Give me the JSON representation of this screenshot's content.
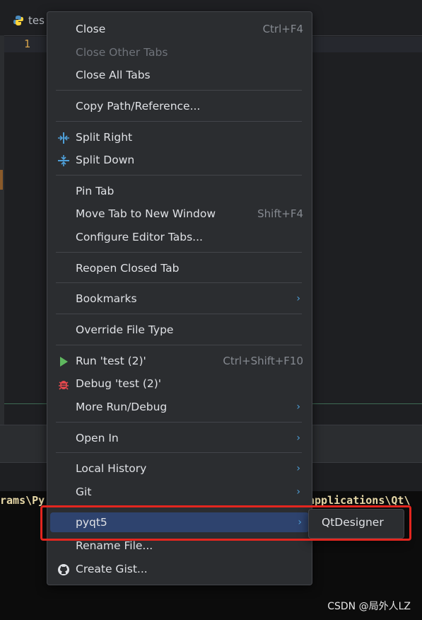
{
  "editor": {
    "tab_title": "tes",
    "line_number": "1",
    "terminal_left": "rams\\Py",
    "terminal_right": "applications\\Qt\\"
  },
  "menu": {
    "close": {
      "label": "Close",
      "shortcut": "Ctrl+F4"
    },
    "close_other": {
      "label": "Close Other Tabs"
    },
    "close_all": {
      "label": "Close All Tabs"
    },
    "copy_path": {
      "label": "Copy Path/Reference..."
    },
    "split_right": {
      "label": "Split Right",
      "icon": "split-right-icon"
    },
    "split_down": {
      "label": "Split Down",
      "icon": "split-down-icon"
    },
    "pin_tab": {
      "label": "Pin Tab"
    },
    "move_tab": {
      "label": "Move Tab to New Window",
      "shortcut": "Shift+F4"
    },
    "configure_tabs": {
      "label": "Configure Editor Tabs..."
    },
    "reopen_closed": {
      "label": "Reopen Closed Tab"
    },
    "bookmarks": {
      "label": "Bookmarks"
    },
    "override_type": {
      "label": "Override File Type"
    },
    "run": {
      "label": "Run 'test (2)'",
      "shortcut": "Ctrl+Shift+F10",
      "icon": "run-icon"
    },
    "debug": {
      "label": "Debug 'test (2)'",
      "icon": "debug-icon"
    },
    "more_run": {
      "label": "More Run/Debug"
    },
    "open_in": {
      "label": "Open In"
    },
    "local_history": {
      "label": "Local History"
    },
    "git": {
      "label": "Git"
    },
    "pyqt5": {
      "label": "pyqt5"
    },
    "rename_file": {
      "label": "Rename File..."
    },
    "create_gist": {
      "label": "Create Gist...",
      "icon": "github-icon"
    }
  },
  "submenu": {
    "qtdesigner": "QtDesigner"
  },
  "watermark": "CSDN @局外人LZ",
  "colors": {
    "menu_bg": "#2b2d30",
    "selected_bg": "#2e436e",
    "accent_arrow": "#4e9fd8",
    "run_green": "#5fb85f",
    "debug_red": "#e5484d",
    "highlight_red": "#e3261f"
  }
}
